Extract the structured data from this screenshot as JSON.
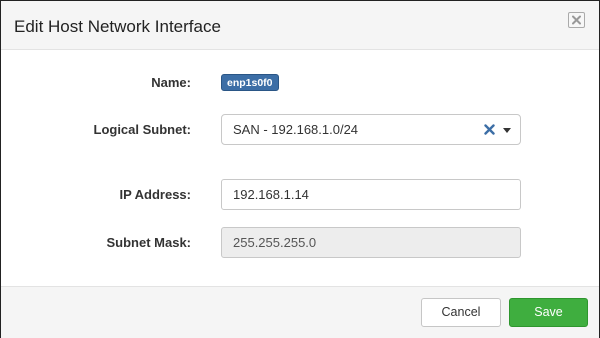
{
  "dialog": {
    "title": "Edit Host Network Interface"
  },
  "form": {
    "name_label": "Name:",
    "name_value": "enp1s0f0",
    "subnet_label": "Logical Subnet:",
    "subnet_value": "SAN - 192.168.1.0/24",
    "ip_label": "IP Address:",
    "ip_value": "192.168.1.14",
    "mask_label": "Subnet Mask:",
    "mask_value": "255.255.255.0"
  },
  "footer": {
    "cancel_label": "Cancel",
    "save_label": "Save"
  },
  "colors": {
    "tag_bg": "#3c6ea6",
    "save_bg": "#3fae3f",
    "clear_icon": "#3c6ea6"
  },
  "icons": {
    "close": "close-icon",
    "clear": "clear-x-icon",
    "dropdown": "caret-down-icon"
  }
}
